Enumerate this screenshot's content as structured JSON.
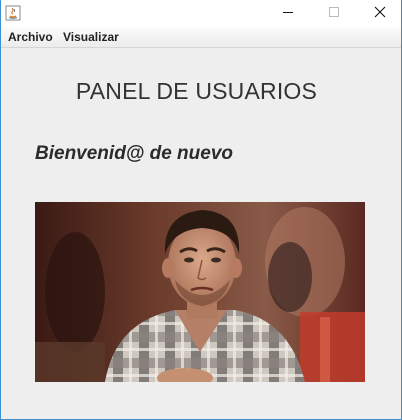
{
  "window": {
    "icon": "java-app-icon",
    "controls": {
      "minimize": "minimize-icon",
      "maximize": "maximize-icon",
      "close": "close-icon"
    }
  },
  "menubar": {
    "items": [
      {
        "label": "Archivo"
      },
      {
        "label": "Visualizar"
      }
    ]
  },
  "panel": {
    "title": "PANEL DE USUARIOS",
    "welcome": "Bienvenid@ de nuevo"
  },
  "colors": {
    "content_bg": "#eeeeee",
    "window_border": "#3c8fd0",
    "title_text": "#333333"
  }
}
